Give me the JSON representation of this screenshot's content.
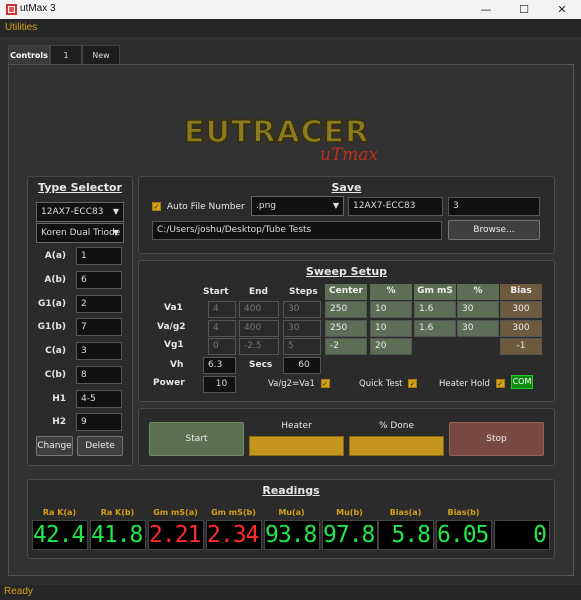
{
  "window": {
    "title": "utMax 3",
    "minimize": "—",
    "maximize": "☐",
    "close": "✕"
  },
  "menu": {
    "utilities": "Utilities"
  },
  "tabs": [
    {
      "label": "Controls"
    },
    {
      "label": "1"
    },
    {
      "label": "New"
    }
  ],
  "type_selector": {
    "title": "Type Selector",
    "tube": "12AX7-ECC83",
    "model": "Koren Dual Triode",
    "params": [
      {
        "label": "A(a)",
        "value": "1"
      },
      {
        "label": "A(b)",
        "value": "6"
      },
      {
        "label": "G1(a)",
        "value": "2"
      },
      {
        "label": "G1(b)",
        "value": "7"
      },
      {
        "label": "C(a)",
        "value": "3"
      },
      {
        "label": "C(b)",
        "value": "8"
      },
      {
        "label": "H1",
        "value": "4-5"
      },
      {
        "label": "H2",
        "value": "9"
      }
    ],
    "change": "Change",
    "delete": "Delete"
  },
  "save": {
    "title": "Save",
    "auto_file_label": "Auto File Number",
    "auto_file_checked": true,
    "format": ".png",
    "name": "12AX7-ECC83",
    "number": "3",
    "path": "C:/Users/joshu/Desktop/Tube Tests",
    "browse": "Browse..."
  },
  "sweep": {
    "title": "Sweep Setup",
    "headers": {
      "start": "Start",
      "end": "End",
      "steps": "Steps",
      "center": "Center",
      "pct": "%",
      "gm": "Gm mS",
      "pct2": "%",
      "bias": "Bias"
    },
    "rows": [
      {
        "label": "Va1",
        "start": "4",
        "end": "400",
        "steps": "30",
        "center": "250",
        "pct": "10",
        "gm": "1.6",
        "pct2": "30",
        "bias": "300"
      },
      {
        "label": "Va/g2",
        "start": "4",
        "end": "400",
        "steps": "30",
        "center": "250",
        "pct": "10",
        "gm": "1.6",
        "pct2": "30",
        "bias": "300"
      },
      {
        "label": "Vg1",
        "start": "0",
        "end": "-2.5",
        "steps": "5",
        "center": "-2",
        "pct": "20",
        "bias": "-1"
      }
    ],
    "vh_label": "Vh",
    "vh": "6.3",
    "secs_label": "Secs",
    "secs": "60",
    "power_label": "Power",
    "power": "10",
    "vag2_label": "Va/g2=Va1",
    "quick_label": "Quick Test",
    "heater_hold_label": "Heater Hold",
    "com": "COM"
  },
  "controls": {
    "start": "Start",
    "heater": "Heater",
    "pct_done": "% Done",
    "stop": "Stop"
  },
  "readings": {
    "title": "Readings",
    "items": [
      {
        "label": "Ra K(a)",
        "value": "42.4",
        "color": "green"
      },
      {
        "label": "Ra K(b)",
        "value": "41.8",
        "color": "green"
      },
      {
        "label": "Gm mS(a)",
        "value": "2.21",
        "color": "red"
      },
      {
        "label": "Gm mS(b)",
        "value": "2.34",
        "color": "red"
      },
      {
        "label": "Mu(a)",
        "value": "93.8",
        "color": "green"
      },
      {
        "label": "Mu(b)",
        "value": "97.8",
        "color": "green"
      },
      {
        "label": "Bias(a)",
        "value": "5.8",
        "color": "green"
      },
      {
        "label": "Bias(b)",
        "value": "6.05",
        "color": "green"
      },
      {
        "label": "",
        "value": "0",
        "color": "green"
      }
    ]
  },
  "logo": {
    "text": "EUTRACER",
    "sub": "uTmax"
  },
  "status": "Ready",
  "colors": {
    "accent": "#d4a017",
    "green_cell": "#5c6e55",
    "brown_cell": "#6e5a3e",
    "start_btn": "#5a7050",
    "stop_btn": "#7a4a42",
    "bar": "#c4961e"
  }
}
